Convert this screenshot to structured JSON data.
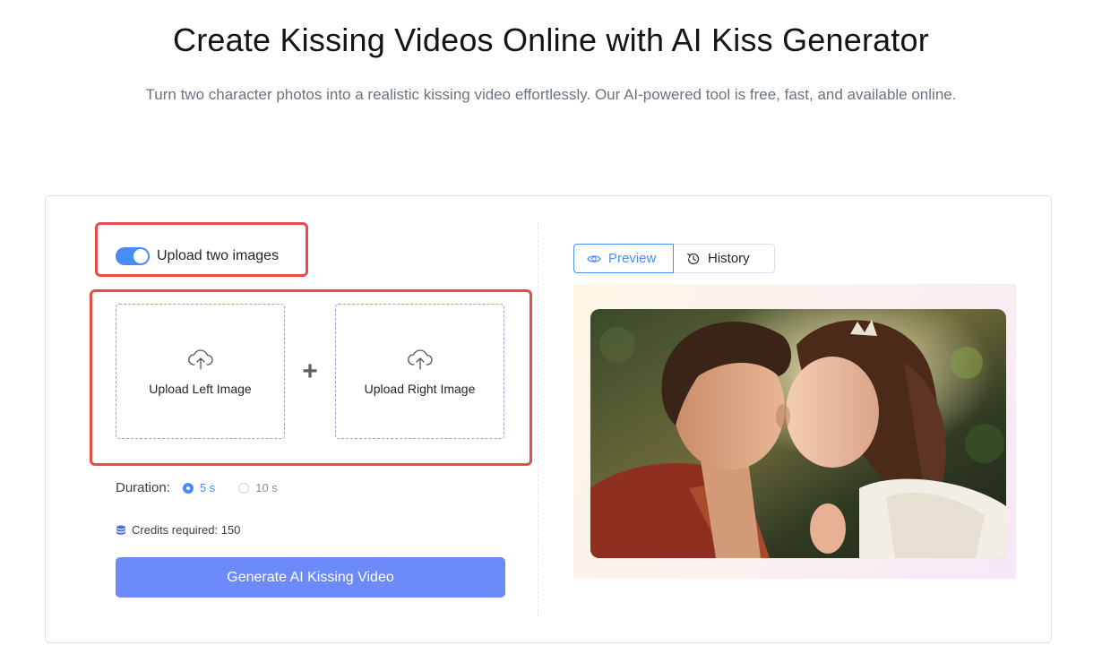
{
  "header": {
    "title": "Create Kissing Videos Online with AI Kiss Generator",
    "subtitle": "Turn two character photos into a realistic kissing video effortlessly. Our AI-powered tool is free, fast, and available online."
  },
  "form": {
    "toggle_label": "Upload two images",
    "toggle_on": true,
    "upload_left_label": "Upload Left Image",
    "upload_right_label": "Upload Right Image",
    "plus": "+",
    "duration_label": "Duration:",
    "duration_options": [
      "5 s",
      "10 s"
    ],
    "duration_selected": "5 s",
    "credits_text": "Credits required: 150",
    "generate_label": "Generate AI Kissing Video"
  },
  "preview": {
    "tabs": [
      "Preview",
      "History"
    ],
    "active_tab": "Preview"
  },
  "icons": {
    "upload": "cloud-upload-icon",
    "preview_tab": "eye-icon",
    "history_tab": "history-icon",
    "credits": "database-icon"
  },
  "colors": {
    "accent": "#4a8cf7",
    "button": "#6d8afb",
    "highlight": "#e94b4b"
  }
}
